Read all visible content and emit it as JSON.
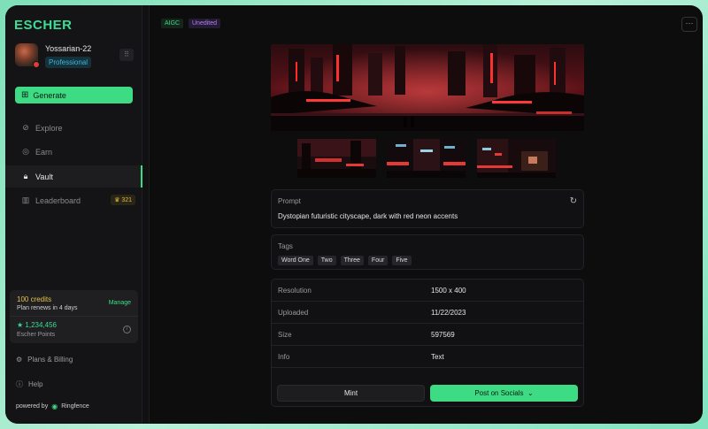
{
  "brand": {
    "name": "ESCHER"
  },
  "profile": {
    "username": "Yossarian-22",
    "plan": "Professional",
    "grid_icon": "grid-icon"
  },
  "sidebar": {
    "generate_label": "Generate",
    "items": [
      {
        "label": "Explore",
        "icon": "compass-icon",
        "active": false
      },
      {
        "label": "Earn",
        "icon": "coins-icon",
        "active": false
      },
      {
        "label": "Vault",
        "icon": "lock-icon",
        "active": true
      },
      {
        "label": "Leaderboard",
        "icon": "podium-icon",
        "active": false,
        "badge": "321"
      }
    ],
    "credits": {
      "title": "100 credits",
      "renew": "Plan renews in 4 days",
      "manage": "Manage",
      "points_value": "1,234,456",
      "points_label": "Escher Points"
    },
    "bottom": [
      {
        "label": "Plans & Billing",
        "icon": "gear-icon"
      },
      {
        "label": "Help",
        "icon": "help-icon"
      }
    ],
    "powered_by": "powered by",
    "powered_brand": "Ringfence"
  },
  "main": {
    "tags": [
      "AIGC",
      "Unedited"
    ],
    "prompt": {
      "label": "Prompt",
      "text": "Dystopian futuristic cityscape, dark with red neon accents"
    },
    "tags_section": {
      "label": "Tags",
      "chips": [
        "Word One",
        "Two",
        "Three",
        "Four",
        "Five"
      ]
    },
    "metadata": [
      {
        "key": "Resolution",
        "value": "1500 x 400"
      },
      {
        "key": "Uploaded",
        "value": "11/22/2023"
      },
      {
        "key": "Size",
        "value": "597569"
      },
      {
        "key": "Info",
        "value": "Text"
      }
    ],
    "actions": {
      "mint": "Mint",
      "post": "Post on Socials"
    }
  },
  "colors": {
    "accent": "#3ddc84",
    "background": "#0d0d0e",
    "neon_red": "#e02424"
  }
}
